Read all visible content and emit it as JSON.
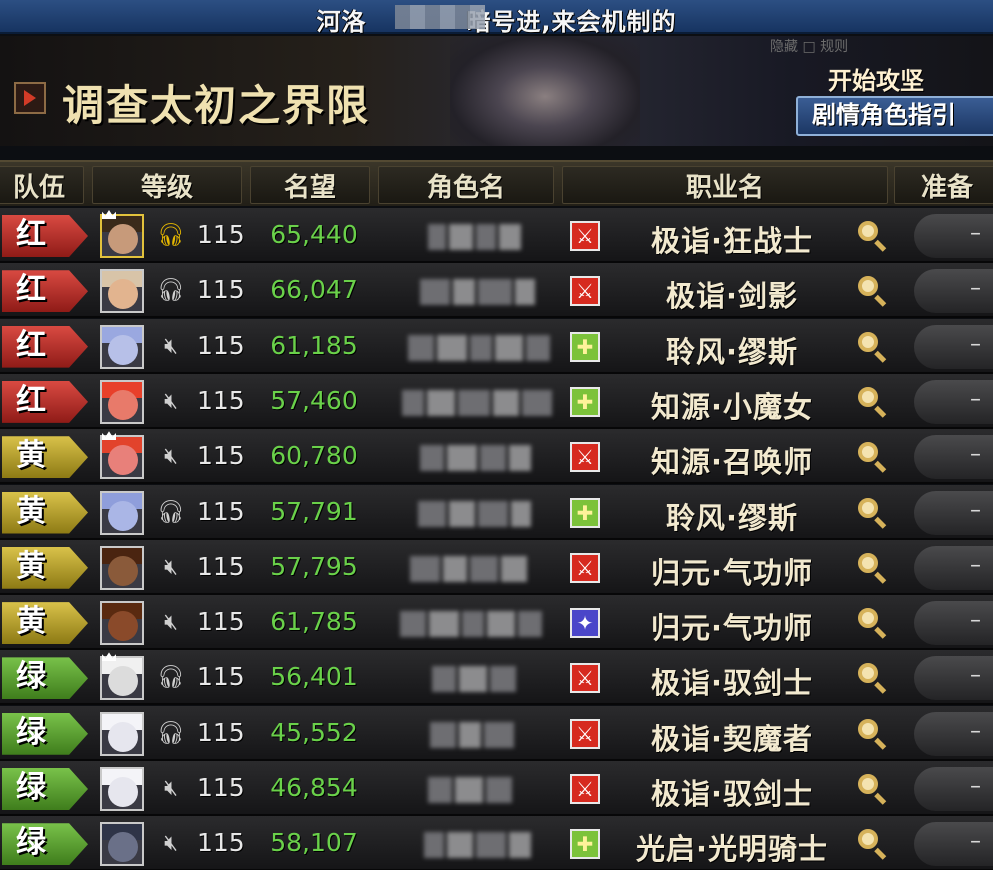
{
  "header": {
    "title_left": "河洛",
    "title_right": "暗号进,来会机制的"
  },
  "banner": {
    "faint_text": "隐藏 □ 规则",
    "quest_title": "调查太初之界限",
    "start_label": "开始攻坚",
    "guide_button": "剧情角色指引"
  },
  "columns": [
    "队伍",
    "等级",
    "名望",
    "角色名",
    "职业名",
    "准备"
  ],
  "rows": [
    {
      "team": "红",
      "team_color": "red",
      "icon": "headset",
      "icon_gold": true,
      "leader": true,
      "level": "115",
      "fame": "65,440",
      "role": "dealer",
      "job": "极诣·狂战士",
      "ready": "–"
    },
    {
      "team": "红",
      "team_color": "red",
      "icon": "headset",
      "icon_gold": false,
      "leader": false,
      "level": "115",
      "fame": "66,047",
      "role": "dealer",
      "job": "极诣·剑影",
      "ready": "–"
    },
    {
      "team": "红",
      "team_color": "red",
      "icon": "mute",
      "icon_gold": false,
      "leader": false,
      "level": "115",
      "fame": "61,185",
      "role": "buffer",
      "job": "聆风·缪斯",
      "ready": "–"
    },
    {
      "team": "红",
      "team_color": "red",
      "icon": "mute",
      "icon_gold": false,
      "leader": false,
      "level": "115",
      "fame": "57,460",
      "role": "buffer",
      "job": "知源·小魔女",
      "ready": "–"
    },
    {
      "team": "黄",
      "team_color": "yellow",
      "icon": "mute",
      "icon_gold": false,
      "leader": true,
      "level": "115",
      "fame": "60,780",
      "role": "dealer",
      "job": "知源·召唤师",
      "ready": "–"
    },
    {
      "team": "黄",
      "team_color": "yellow",
      "icon": "headset",
      "icon_gold": false,
      "leader": false,
      "level": "115",
      "fame": "57,791",
      "role": "buffer",
      "job": "聆风·缪斯",
      "ready": "–"
    },
    {
      "team": "黄",
      "team_color": "yellow",
      "icon": "mute",
      "icon_gold": false,
      "leader": false,
      "level": "115",
      "fame": "57,795",
      "role": "dealer",
      "job": "归元·气功师",
      "ready": "–"
    },
    {
      "team": "黄",
      "team_color": "yellow",
      "icon": "mute",
      "icon_gold": false,
      "leader": false,
      "level": "115",
      "fame": "61,785",
      "role": "synergy",
      "job": "归元·气功师",
      "ready": "–"
    },
    {
      "team": "绿",
      "team_color": "green",
      "icon": "headset",
      "icon_gold": false,
      "leader": true,
      "level": "115",
      "fame": "56,401",
      "role": "dealer",
      "job": "极诣·驭剑士",
      "ready": "–"
    },
    {
      "team": "绿",
      "team_color": "green",
      "icon": "headset",
      "icon_gold": false,
      "leader": false,
      "level": "115",
      "fame": "45,552",
      "role": "dealer",
      "job": "极诣·契魔者",
      "ready": "–"
    },
    {
      "team": "绿",
      "team_color": "green",
      "icon": "mute",
      "icon_gold": false,
      "leader": false,
      "level": "115",
      "fame": "46,854",
      "role": "dealer",
      "job": "极诣·驭剑士",
      "ready": "–"
    },
    {
      "team": "绿",
      "team_color": "green",
      "icon": "mute",
      "icon_gold": false,
      "leader": false,
      "level": "115",
      "fame": "58,107",
      "role": "buffer",
      "job": "光启·光明骑士",
      "ready": "–"
    }
  ]
}
